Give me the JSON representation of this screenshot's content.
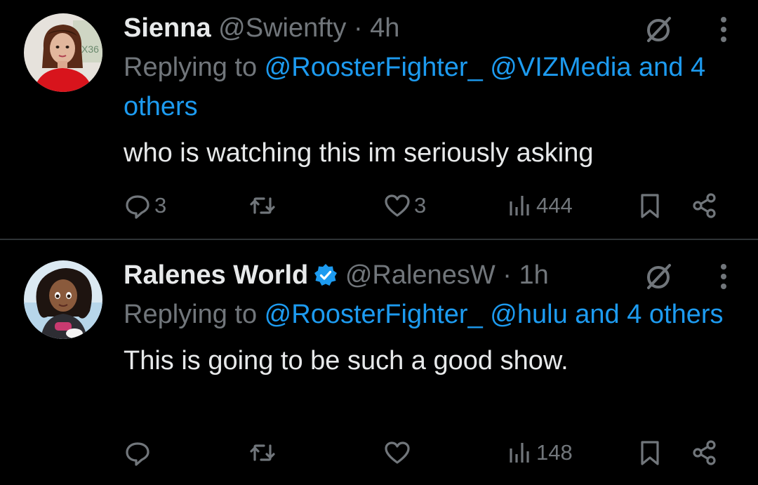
{
  "tweets": [
    {
      "name": "Sienna",
      "handle": "@Swienfty",
      "separator": "·",
      "time": "4h",
      "replying_prefix": "Replying to ",
      "mention1": "@RoosterFighter_",
      "mention2": "@VIZMedia",
      "others": "and 4 others",
      "text": "who is watching this im seriously asking",
      "replies": "3",
      "retweets": "",
      "likes": "3",
      "views": "444",
      "avatar_badge_text": "X36"
    },
    {
      "name": "Ralenes World",
      "handle": "@RalenesW",
      "separator": "·",
      "time": "1h",
      "replying_prefix": "Replying to ",
      "mention1": "@RoosterFighter_",
      "mention2": "@hulu",
      "others": "and 4 others",
      "text": "This is going to be such a good show.",
      "replies": "",
      "retweets": "",
      "likes": "",
      "views": "148"
    }
  ],
  "colors": {
    "background": "#000000",
    "text": "#e7e9ea",
    "muted": "#71767b",
    "link": "#1d9bf0",
    "divider": "#2f3336"
  },
  "icons": [
    "grok-icon",
    "more-icon",
    "reply-icon",
    "retweet-icon",
    "like-icon",
    "views-icon",
    "bookmark-icon",
    "share-icon",
    "verified-badge-icon"
  ]
}
